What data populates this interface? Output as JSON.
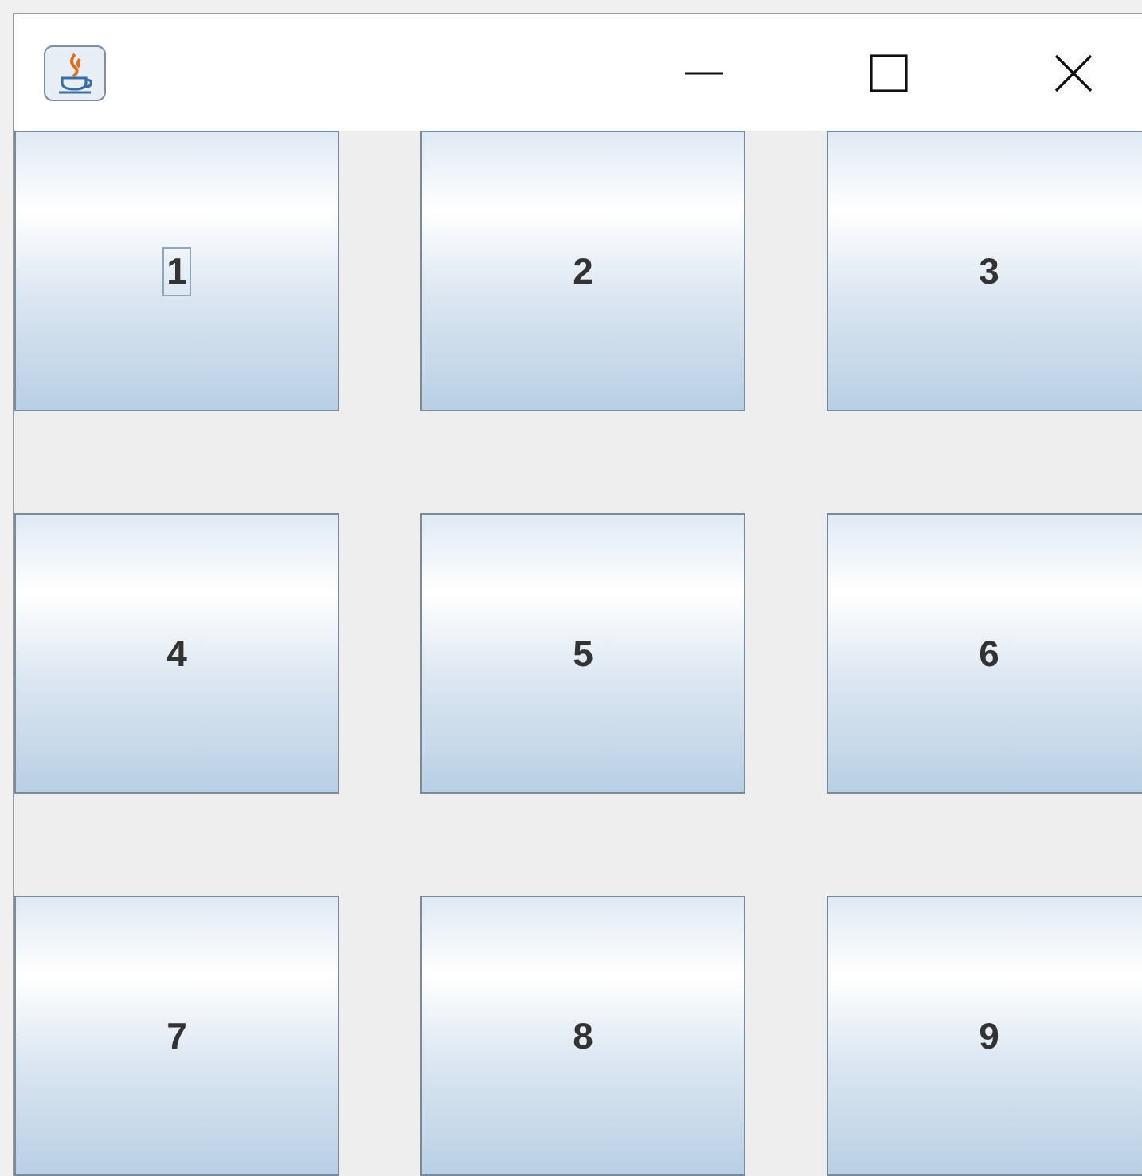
{
  "window": {
    "controls": [
      {
        "kind": "minimize"
      },
      {
        "kind": "maximize"
      },
      {
        "kind": "close"
      }
    ]
  },
  "buttons": [
    {
      "label": "1",
      "focused": true
    },
    {
      "label": "2",
      "focused": false
    },
    {
      "label": "3",
      "focused": false
    },
    {
      "label": "4",
      "focused": false
    },
    {
      "label": "5",
      "focused": false
    },
    {
      "label": "6",
      "focused": false
    },
    {
      "label": "7",
      "focused": false
    },
    {
      "label": "8",
      "focused": false
    },
    {
      "label": "9",
      "focused": false
    }
  ]
}
